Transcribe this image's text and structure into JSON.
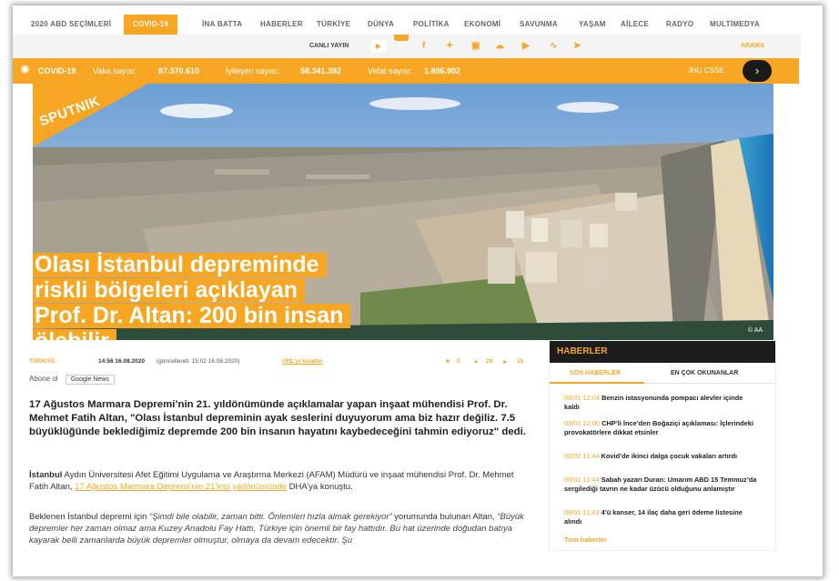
{
  "nav": {
    "items": [
      "2020 ABD SEÇİMLERİ",
      "COVID-19",
      "İNA BATTA",
      "HABERLER",
      "TÜRKİYE",
      "DÜNYA",
      "POLİTİKA",
      "EKONOMİ",
      "SAVUNMA",
      "YAŞAM",
      "AİLECE",
      "RADYO",
      "MULTİMEDYA"
    ],
    "active": "COVID-19"
  },
  "socialbar": {
    "live_label": "CANLI YAYIN",
    "search_label": "ARAMA",
    "icons": [
      "facebook-icon",
      "twitter-icon",
      "instagram-icon",
      "soundcloud-icon",
      "youtube-icon",
      "rss-icon",
      "telegram-icon"
    ]
  },
  "covid": {
    "title": "COVID-19",
    "cases_label": "Vaka sayısı:",
    "cases_value": "87.370.610",
    "recovered_label": "İyileşen sayısı:",
    "recovered_value": "58.341.392",
    "deaths_label": "Vefat sayısı:",
    "deaths_value": "1.886.902",
    "source": "JHU CSSE",
    "arrow": "›"
  },
  "hero": {
    "logo": "SPUTNIK",
    "headline_lines": [
      "Olası İstanbul depreminde",
      "riskli bölgeleri açıklayan",
      "Prof. Dr. Altan: 200 bin insan",
      "ölebilir"
    ],
    "photo_credit": "© AA"
  },
  "meta": {
    "category": "TÜRKİYE",
    "date": "14:56 16.08.2020",
    "updated": "(güncellendi: 15:02 16.08.2020)",
    "short_link": "URL'yi kısaltın",
    "comments": "0",
    "likes": "29",
    "shares": "15"
  },
  "subscribe": {
    "label": "Abone ol",
    "button": "Google News"
  },
  "article": {
    "lead": "17 Ağustos Marmara Depremi’nin 21. yıldönümünde açıklamalar yapan inşaat mühendisi Prof. Dr. Mehmet Fatih Altan, \"Olası İstanbul depreminin ayak seslerini duyuyorum ama biz hazır değiliz. 7.5 büyüklüğünde beklediğimiz depremde 200 bin insanın hayatını kaybedeceğini tahmin ediyoruz\" dedi.",
    "p1_bold": "İstanbul",
    "p1_text": " Aydın Üniversitesi Afet Eğitimi Uygulama ve Araştırma Merkezi (AFAM) Müdürü ve inşaat mühendisi Prof. Dr. Mehmet Fatih Altan, ",
    "p1_link": "17 Ağustos Marmara Depremi’nin 21’inci yıldönümünde",
    "p1_end": " DHA’ya konuştu.",
    "p2_start": "Beklenen İstanbul depremi için ",
    "p2_quote1": "“Şimdi bile olabilir, zaman bitti. Önlemleri hızla almak gerekiyor”",
    "p2_mid": " yorumunda bulunan Altan, ",
    "p2_quote2": "“Büyük depremler her zaman olmaz ama Kuzey Anadolu Fay Hattı, Türkiye için önemli bir fay hattıdır. Bu hat üzerinde doğudan batıya kayarak belli zamanlarda büyük depremler olmuştur, olmaya da devam edecektir. Şu"
  },
  "sidebar": {
    "title": "HABERLER",
    "tab_latest": "SON HABERLER",
    "tab_popular": "EN ÇOK OKUNANLAR",
    "news": [
      {
        "time": "08/01 12:04",
        "text": "Benzin istasyonunda pompacı alevler içinde kaldı"
      },
      {
        "time": "08/01 12:00",
        "text": "CHP’li İnce’den Boğaziçi açıklaması: İçlerindeki provokatörlere dikkat etsinler"
      },
      {
        "time": "08/01 11:44",
        "text": "Kovid’de ikinci dalga çocuk vakaları artırdı"
      },
      {
        "time": "08/01 11:44",
        "text": "Sabah yazarı Duran: Umarım ABD 15 Temmuz’da sergilediği tavrın ne kadar üzücü olduğunu anlamıştır"
      },
      {
        "time": "08/01 11:43",
        "text": "4’ü kanser, 14 ilaç daha geri ödeme listesine alındı"
      }
    ],
    "all_link": "Tüm haberler"
  },
  "colors": {
    "accent": "#f6a623",
    "dark": "#1c1c1c"
  }
}
